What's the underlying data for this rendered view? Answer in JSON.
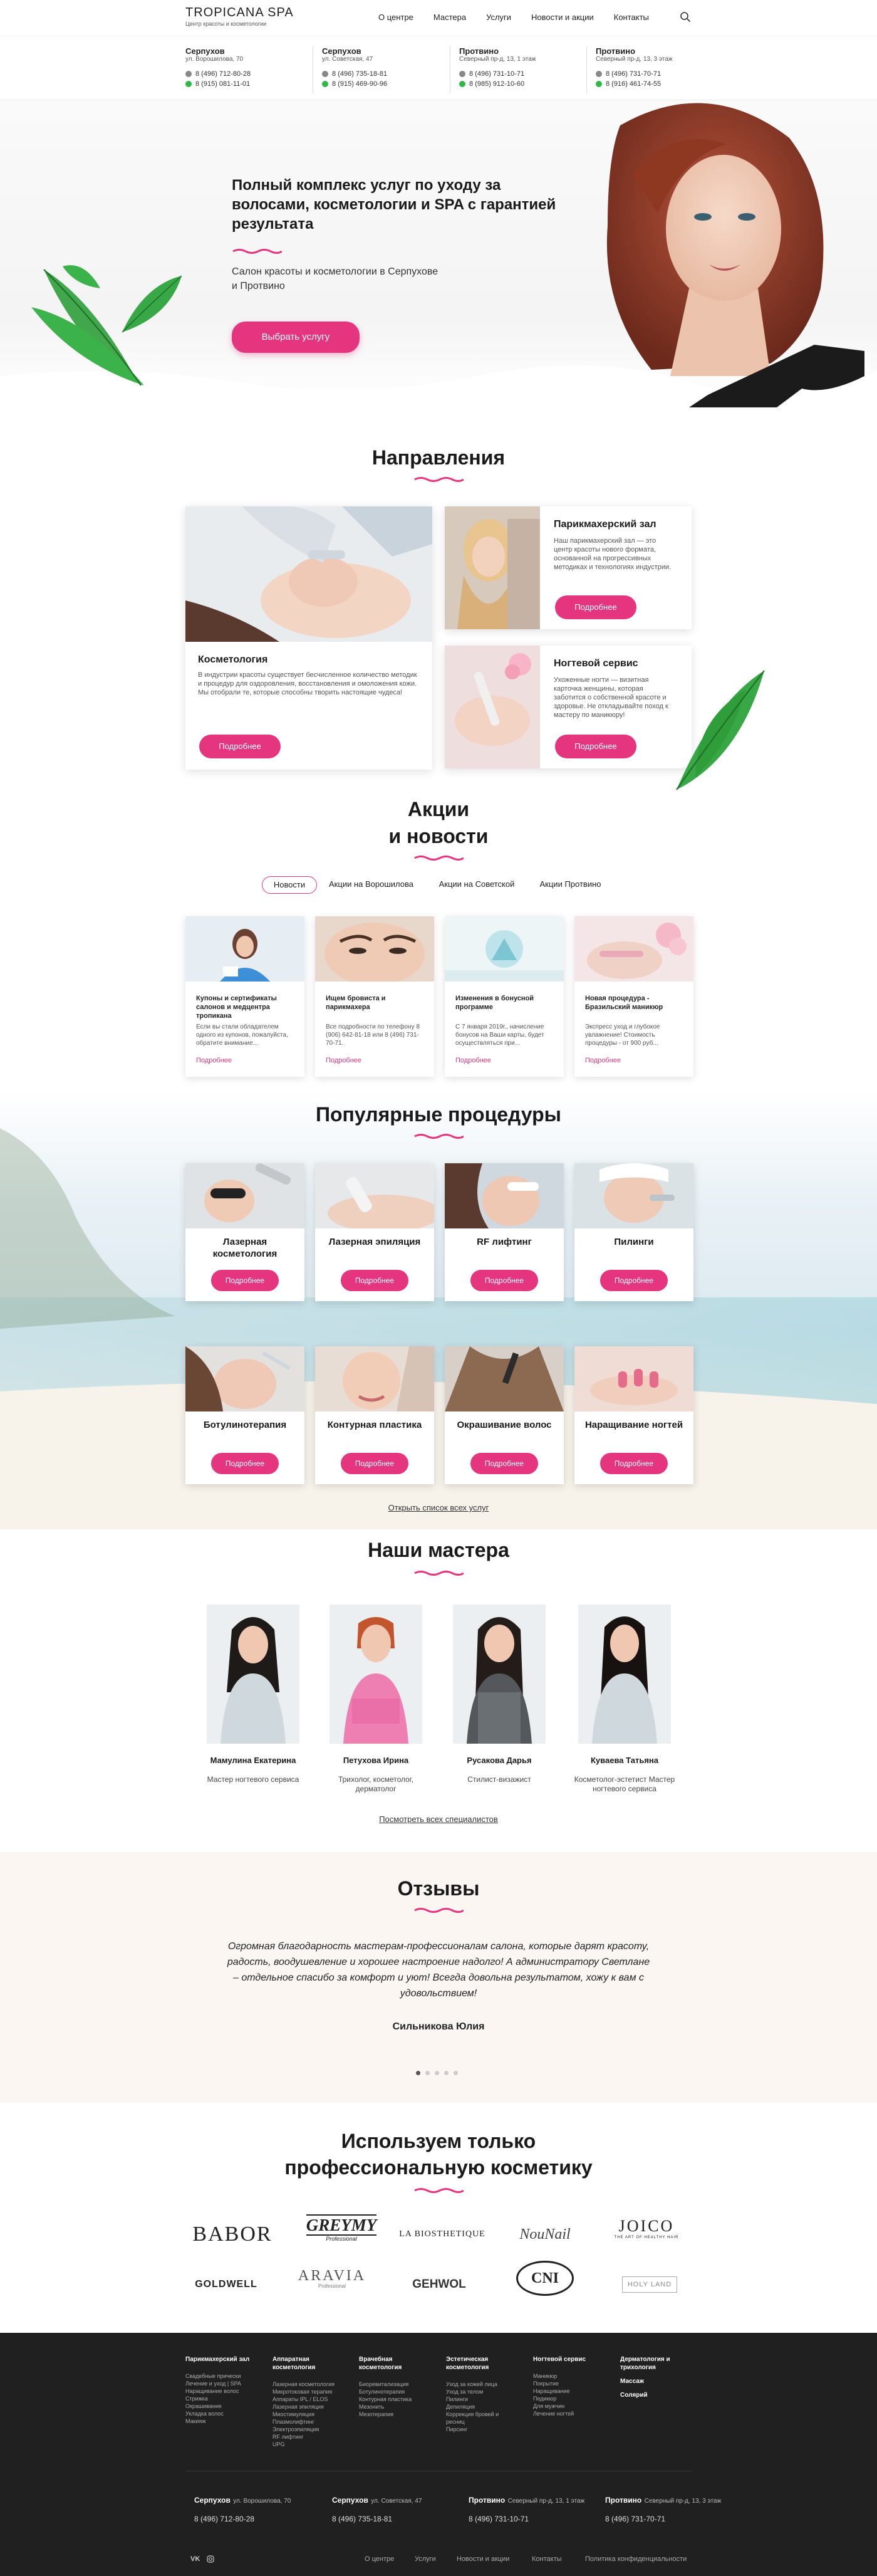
{
  "header": {
    "logo_title": "TROPICANA SPA",
    "logo_subtitle": "Центр красоты и косметологии",
    "nav": [
      "О центре",
      "Мастера",
      "Услуги",
      "Новости и акции",
      "Контакты"
    ]
  },
  "contacts": [
    {
      "city": "Серпухов",
      "address": "ул. Ворошилова, 70",
      "phone1": "8 (496) 712-80-28",
      "phone2": "8 (915) 081-11-01"
    },
    {
      "city": "Серпухов",
      "address": "ул. Советская, 47",
      "phone1": "8 (496) 735-18-81",
      "phone2": "8 (915) 469-90-96"
    },
    {
      "city": "Протвино",
      "address": "Северный пр-д, 13, 1 этаж",
      "phone1": "8 (496) 731-10-71",
      "phone2": "8 (985) 912-10-60"
    },
    {
      "city": "Протвино",
      "address": "Северный пр-д, 13, 3 этаж",
      "phone1": "8 (496) 731-70-71",
      "phone2": "8 (916) 461-74-55"
    }
  ],
  "hero": {
    "title": "Полный комплекс услуг по уходу за волосами, косметологии и SPA с гарантией результата",
    "subtitle": "Салон красоты и косметологии в Серпухове и Протвино",
    "button": "Выбрать услугу"
  },
  "directions": {
    "title": "Направления",
    "cosmetology": {
      "title": "Косметология",
      "text": "В индустрии красоты существует бесчисленное количество методик и процедур для оздоровления, восстановления и омоложения кожи. Мы отобрали те, которые способны творить настоящие чудеса!",
      "button": "Подробнее"
    },
    "hair": {
      "title": "Парикмахерский зал",
      "text": "Наш парикмахерский зал — это центр красоты нового формата, основанной на прогрессивных методиках и технологиях индустрии.",
      "button": "Подробнее"
    },
    "nails": {
      "title": "Ногтевой сервис",
      "text": "Ухоженные ногти — визитная карточка женщины, которая заботится о собственной красоте и здоровье. Не откладывайте поход к мастеру по маникюру!",
      "button": "Подробнее"
    }
  },
  "news": {
    "title_line1": "Акции",
    "title_line2": "и новости",
    "tabs": [
      "Новости",
      "Акции на Ворошилова",
      "Акции на Советской",
      "Акции Протвино"
    ],
    "items": [
      {
        "title": "Купоны и сертификаты салонов и медцентра тропикана",
        "text": "Если вы стали обладателем одного из купонов, пожалуйста, обратите внимание...",
        "more": "Подробнее"
      },
      {
        "title": "Ищем бровиста и парикмахера",
        "text": "Все подробности по телефону 8 (906) 642-81-18 или 8 (496) 731-70-71.",
        "more": "Подробнее"
      },
      {
        "title": "Изменения в бонусной программе",
        "text": "С 7 января 2019г., начисление бонусов на Ваши карты, будет осуществляться при...",
        "more": "Подробнее"
      },
      {
        "title": "Новая процедура - Бразильский маникюр",
        "text": "Экспресс уход и глубокое увлажнение! Стоимость процедуры - от 900 руб...",
        "more": "Подробнее"
      }
    ]
  },
  "procedures": {
    "title": "Популярные процедуры",
    "button": "Подробнее",
    "items": [
      "Лазерная косметология",
      "Лазерная эпиляция",
      "RF лифтинг",
      "Пилинги",
      "Ботулинотерапия",
      "Контурная пластика",
      "Окрашивание волос",
      "Наращивание ногтей"
    ],
    "all_link": "Открыть список всех услуг"
  },
  "masters": {
    "title": "Наши мастера",
    "items": [
      {
        "name": "Мамулина Екатерина",
        "role": "Мастер ногтевого сервиса"
      },
      {
        "name": "Петухова Ирина",
        "role": "Трихолог, косметолог, дерматолог"
      },
      {
        "name": "Русакова Дарья",
        "role": "Стилист-визажист"
      },
      {
        "name": "Куваева Татьяна",
        "role": "Косметолог-эстетист Мастер ногтевого сервиса"
      }
    ],
    "all_link": "Посмотреть всех специалистов"
  },
  "reviews": {
    "title": "Отзывы",
    "text": "Огромная благодарность мастерам-профессионалам салона, которые дарят красоту, радость, воодушевление и хорошее настроение надолго! А администратору Светлане – отдельное спасибо за комфорт и уют! Всегда довольна результатом, хожу к вам с удовольствием!",
    "author": "Сильникова Юлия"
  },
  "brands": {
    "title_line1": "Используем только",
    "title_line2": "профессиональную косметику",
    "row1": [
      "BABOR",
      "GREYMY",
      "LA BIOSTHETIQUE",
      "NouNail",
      "JOICO"
    ],
    "row2": [
      "GOLDWELL",
      "ARAVIA",
      "GEHWOL",
      "CNI",
      "HOLY LAND"
    ],
    "sub": {
      "GREYMY": "Professional",
      "ARAVIA": "Professional",
      "JOICO": "THE ART OF HEALTHY HAIR"
    }
  },
  "footer": {
    "cols": [
      {
        "head": "Парикмахерский зал",
        "items": [
          "Свадебные прически",
          "Лечение и уход | SPA",
          "Наращивание волос",
          "Стрижка",
          "Окрашивание",
          "Укладка волос",
          "Макияж"
        ]
      },
      {
        "head": "Аппаратная косметология",
        "items": [
          "Лазерная косметология",
          "Микротоковая терапия",
          "Аппараты IPL / ELOS",
          "Лазерная эпиляция",
          "Миостимуляция",
          "Плазмолифтинг",
          "Электроэпиляция",
          "RF лифтинг",
          "UPG"
        ]
      },
      {
        "head": "Врачебная косметология",
        "items": [
          "Биоревитализация",
          "Ботулинотерапия",
          "Контурная пластика",
          "Мезонить",
          "Мезотерапия"
        ]
      },
      {
        "head": "Эстетическая косметология",
        "items": [
          "Уход за кожей лица",
          "Уход за телом",
          "Пилинги",
          "Депиляция",
          "Коррекция бровей и ресниц",
          "Пирсинг"
        ]
      },
      {
        "head": "Ногтевой сервис",
        "items": [
          "Маникюр",
          "Покрытие",
          "Наращивание",
          "Педикюр",
          "Для мужчин",
          "Лечение ногтей"
        ]
      }
    ],
    "extra_heads": [
      "Дерматология и трихология",
      "Массаж",
      "Солярий"
    ],
    "contacts": [
      {
        "city": "Серпухов",
        "address": "ул. Ворошилова, 70",
        "phone": "8 (496) 712-80-28"
      },
      {
        "city": "Серпухов",
        "address": "ул. Советская, 47",
        "phone": "8 (496) 735-18-81"
      },
      {
        "city": "Протвино",
        "address": "Северный пр-д, 13, 1 этаж",
        "phone": "8 (496) 731-10-71"
      },
      {
        "city": "Протвино",
        "address": "Северный пр-д, 13, 3 этаж",
        "phone": "8 (496) 731-70-71"
      }
    ],
    "social": [
      "vk-icon",
      "instagram-icon"
    ],
    "links": [
      "О центре",
      "Услуги",
      "Новости и акции",
      "Контакты",
      "Политика конфиденциальности"
    ]
  },
  "colors": {
    "accent": "#e5357f",
    "footer": "#202020",
    "reviews_bg": "#fbf6f2"
  }
}
